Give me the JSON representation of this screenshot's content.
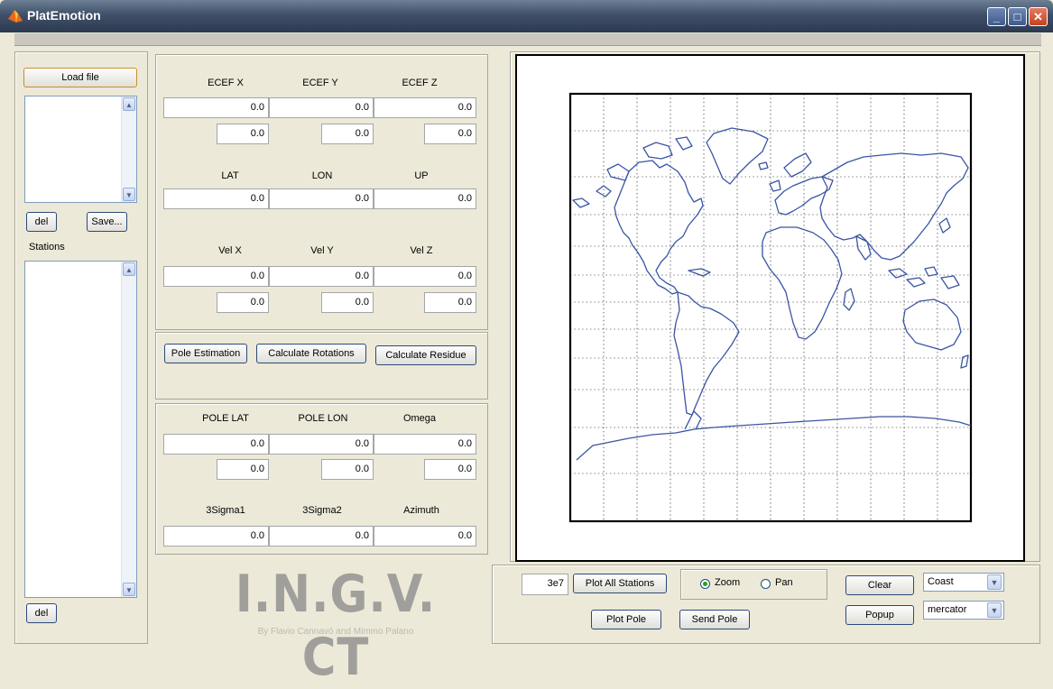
{
  "window": {
    "title": "PlatEmotion",
    "min_glyph": "_",
    "max_glyph": "□",
    "close_glyph": "✕"
  },
  "left": {
    "load_file": "Load file",
    "del": "del",
    "save": "Save...",
    "stations_label": "Stations",
    "del2": "del"
  },
  "coords": {
    "ecef_headers": [
      "ECEF X",
      "ECEF Y",
      "ECEF Z"
    ],
    "ecef_values": [
      "0.0",
      "0.0",
      "0.0"
    ],
    "ecef_sigma": [
      "0.0",
      "0.0",
      "0.0"
    ],
    "geo_headers": [
      "LAT",
      "LON",
      "UP"
    ],
    "geo_values": [
      "0.0",
      "0.0",
      "0.0"
    ],
    "vel_headers": [
      "Vel X",
      "Vel Y",
      "Vel Z"
    ],
    "vel_values": [
      "0.0",
      "0.0",
      "0.0"
    ],
    "vel_sigma": [
      "0.0",
      "0.0",
      "0.0"
    ]
  },
  "actions": {
    "pole_estimation": "Pole Estimation",
    "calc_rotations": "Calculate Rotations",
    "calc_residue": "Calculate Residue"
  },
  "pole": {
    "headers": [
      "POLE LAT",
      "POLE LON",
      "Omega"
    ],
    "values": [
      "0.0",
      "0.0",
      "0.0"
    ],
    "sigma": [
      "0.0",
      "0.0",
      "0.0"
    ],
    "err_headers": [
      "3Sigma1",
      "3Sigma2",
      "Azimuth"
    ],
    "err_values": [
      "0.0",
      "0.0",
      "0.0"
    ]
  },
  "logo": {
    "text": "I.N.G.V. CT",
    "credit": "By Flavio Cannavò and Mimmo Palano"
  },
  "controls": {
    "scale_value": "3e7",
    "plot_all": "Plot All Stations",
    "plot_pole": "Plot Pole",
    "send_pole": "Send Pole",
    "zoom": "Zoom",
    "pan": "Pan",
    "clear": "Clear",
    "popup": "Popup",
    "coast": "Coast",
    "projection": "mercator"
  },
  "colors": {
    "coastline": "#3a55a4",
    "titlebar": "#3f5068",
    "face": "#ece9d8"
  }
}
